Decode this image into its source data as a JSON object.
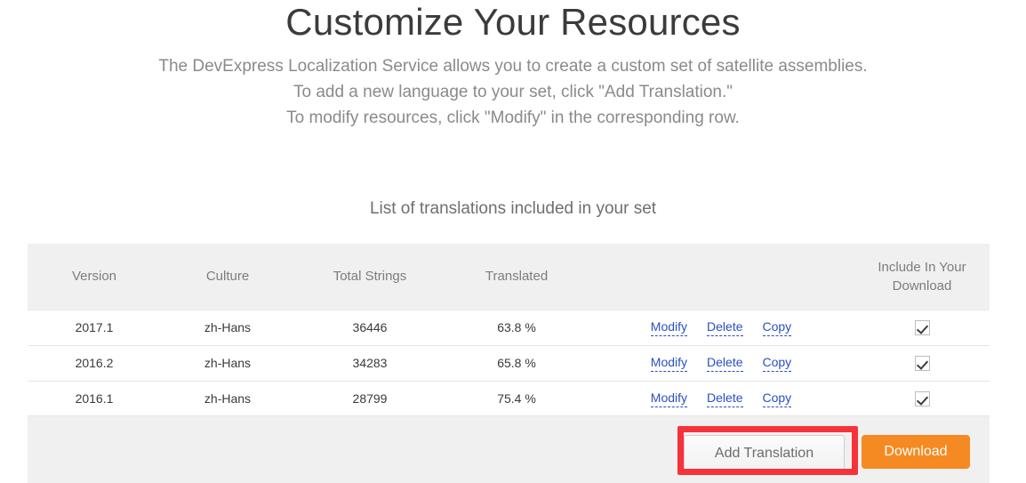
{
  "header": {
    "title": "Customize Your Resources",
    "subtitle_lines": [
      "The DevExpress Localization Service allows you to create a custom set of satellite assemblies.",
      "To add a new language to your set, click \"Add Translation.\"",
      "To modify resources, click \"Modify\" in the corresponding row."
    ]
  },
  "section": {
    "title": "List of translations included in your set"
  },
  "table": {
    "columns": [
      "Version",
      "Culture",
      "Total Strings",
      "Translated",
      "",
      "Include In Your Download"
    ],
    "rows": [
      {
        "version": "2017.1",
        "culture": "zh-Hans",
        "total_strings": "36446",
        "translated": "63.8 %",
        "actions": [
          "Modify",
          "Delete",
          "Copy"
        ],
        "included": true
      },
      {
        "version": "2016.2",
        "culture": "zh-Hans",
        "total_strings": "34283",
        "translated": "65.8 %",
        "actions": [
          "Modify",
          "Delete",
          "Copy"
        ],
        "included": true
      },
      {
        "version": "2016.1",
        "culture": "zh-Hans",
        "total_strings": "28799",
        "translated": "75.4 %",
        "actions": [
          "Modify",
          "Delete",
          "Copy"
        ],
        "included": true
      }
    ]
  },
  "footer": {
    "add_translation_label": "Add Translation",
    "download_label": "Download"
  },
  "annotation": {
    "highlight_target": "Add Translation",
    "highlight_color": "#f6333a"
  },
  "colors": {
    "download_button": "#f58a22",
    "link": "#2a4fc4",
    "header_row_bg": "#f0f0f0",
    "footer_bg": "#f0f0f0"
  }
}
